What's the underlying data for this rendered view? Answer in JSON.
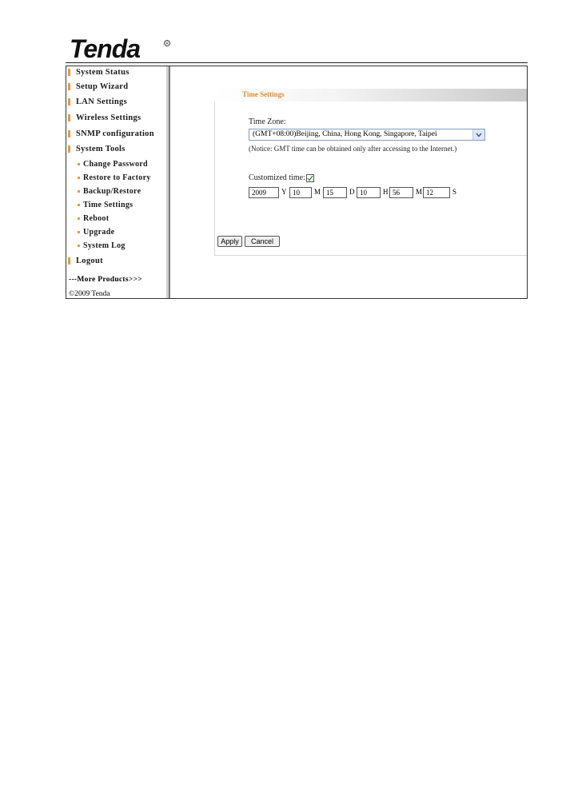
{
  "brand": {
    "logo_text": "Tenda"
  },
  "sidebar": {
    "items": [
      {
        "label": "System Status",
        "type": "main"
      },
      {
        "label": "Setup Wizard",
        "type": "main"
      },
      {
        "label": "LAN Settings",
        "type": "main"
      },
      {
        "label": "Wireless Settings",
        "type": "main"
      },
      {
        "label": "SNMP configuration",
        "type": "main"
      },
      {
        "label": "System Tools",
        "type": "main"
      },
      {
        "label": "Change Password",
        "type": "sub"
      },
      {
        "label": "Restore to Factory",
        "type": "sub"
      },
      {
        "label": "Backup/Restore",
        "type": "sub"
      },
      {
        "label": "Time Settings",
        "type": "sub"
      },
      {
        "label": "Reboot",
        "type": "sub"
      },
      {
        "label": "Upgrade",
        "type": "sub"
      },
      {
        "label": "System Log",
        "type": "sub"
      },
      {
        "label": "Logout",
        "type": "main"
      }
    ],
    "more_products": "---More Products>>>",
    "copyright": "©2009 Tenda"
  },
  "time_settings": {
    "title": "Time Settings",
    "timezone_label": "Time Zone:",
    "timezone_value": "(GMT+08:00)Beijing, China, Hong Kong, Singapore, Taipei",
    "notice": "(Notice: GMT time can be obtained only after accessing to the Internet.)",
    "custom_time_label": "Customized time:",
    "custom_time_checked": true,
    "year": "2009",
    "year_unit": "Y",
    "month": "10",
    "month_unit": "M",
    "day": "15",
    "day_unit": "D",
    "hour": "10",
    "hour_unit": "H",
    "minute": "56",
    "minute_unit": "M",
    "second": "12",
    "second_unit": "S"
  },
  "buttons": {
    "apply": "Apply",
    "cancel": "Cancel"
  },
  "colors": {
    "accent": "#e08a2c",
    "bullet": "#e89a3a"
  }
}
